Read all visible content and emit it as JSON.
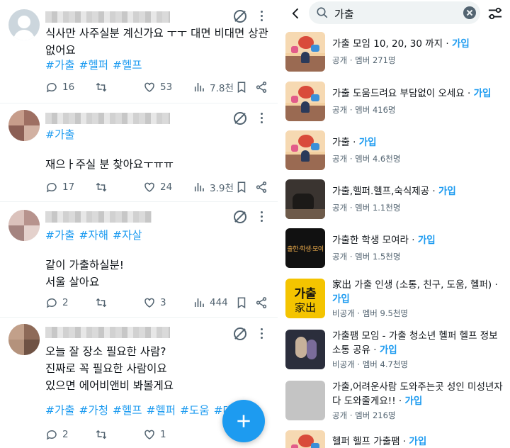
{
  "feed": {
    "tweets": [
      {
        "text": "식사만 사주실분 계신가요 ㅜㅜ 대면 비대면 상관 없어요",
        "tags": [
          "#가출",
          "#헬퍼",
          "#헬프"
        ],
        "replies": "16",
        "retweets": "",
        "likes": "53",
        "views": "7.8천"
      },
      {
        "text": "재으ㅏ주실 분 찾아요ㅜㅠㅠ",
        "tags": [
          "#가출"
        ],
        "replies": "17",
        "retweets": "",
        "likes": "24",
        "views": "3.9천"
      },
      {
        "text": "같이 가출하실분!\n서울 살아요",
        "tags": [
          "#가출",
          "#자해",
          "#자살"
        ],
        "replies": "2",
        "retweets": "",
        "likes": "3",
        "views": "444"
      },
      {
        "text": "오늘 잘 장소 필요한 사람?\n진짜로 꼭 필요한 사람이요\n있으면 에어비앤비 봐볼게요",
        "tags": [
          "#가출",
          "#가청",
          "#헬프",
          "#헬퍼",
          "#도움",
          "#대면"
        ],
        "replies": "2",
        "retweets": "",
        "likes": "1",
        "views": ""
      }
    ]
  },
  "search": {
    "query": "가출"
  },
  "groups": [
    {
      "name": "가출 모임 10, 20, 30 까지",
      "join": "가입",
      "visibility": "공개",
      "members": "멤버 271명",
      "thumb": "illustration"
    },
    {
      "name": "가출 도움드려요 부담없이 오세요",
      "join": "가입",
      "visibility": "공개",
      "members": "멤버 416명",
      "thumb": "illustration"
    },
    {
      "name": "가출",
      "join": "가입",
      "visibility": "공개",
      "members": "멤버 4.6천명",
      "thumb": "illustration"
    },
    {
      "name": "가출,헬퍼.헬프,숙식제공",
      "join": "가입",
      "visibility": "공개",
      "members": "멤버 1.1천명",
      "thumb": "photo"
    },
    {
      "name": "가출한 학생 모여라",
      "join": "가입",
      "visibility": "공개",
      "members": "멤버 1.5천명",
      "thumb": "black",
      "thumb_text": "출한·학생·모여"
    },
    {
      "name": "家出 가출 인생 (소통, 친구, 도움, 헬퍼)",
      "join": "가입",
      "visibility": "비공개",
      "members": "멤버 9.5천명",
      "thumb": "yellow",
      "thumb_text_1": "가출",
      "thumb_text_2": "家出"
    },
    {
      "name": "가출팸 모임 - 가출 청소년 헬퍼 헬프 정보 소통 공유",
      "join": "가입",
      "visibility": "비공개",
      "members": "멤버 4.7천명",
      "thumb": "dark"
    },
    {
      "name": "가출,어려운사람 도와주는곳 성인 미성년자 다 도와줄게요!!",
      "join": "가입",
      "visibility": "공개",
      "members": "멤버 216명",
      "thumb": "grey"
    },
    {
      "name": "헬퍼 헬프 가출팸",
      "join": "가입",
      "visibility": "",
      "members": "",
      "thumb": "illustration"
    }
  ],
  "colors": {
    "accent": "#1d9bf0",
    "text": "#0f1419",
    "muted": "#536471"
  },
  "icons": [
    "reply-icon",
    "retweet-icon",
    "like-icon",
    "views-icon",
    "bookmark-icon",
    "share-icon",
    "mute-icon",
    "more-icon",
    "search-icon",
    "back-icon",
    "clear-icon",
    "filter-icon",
    "compose-icon"
  ]
}
